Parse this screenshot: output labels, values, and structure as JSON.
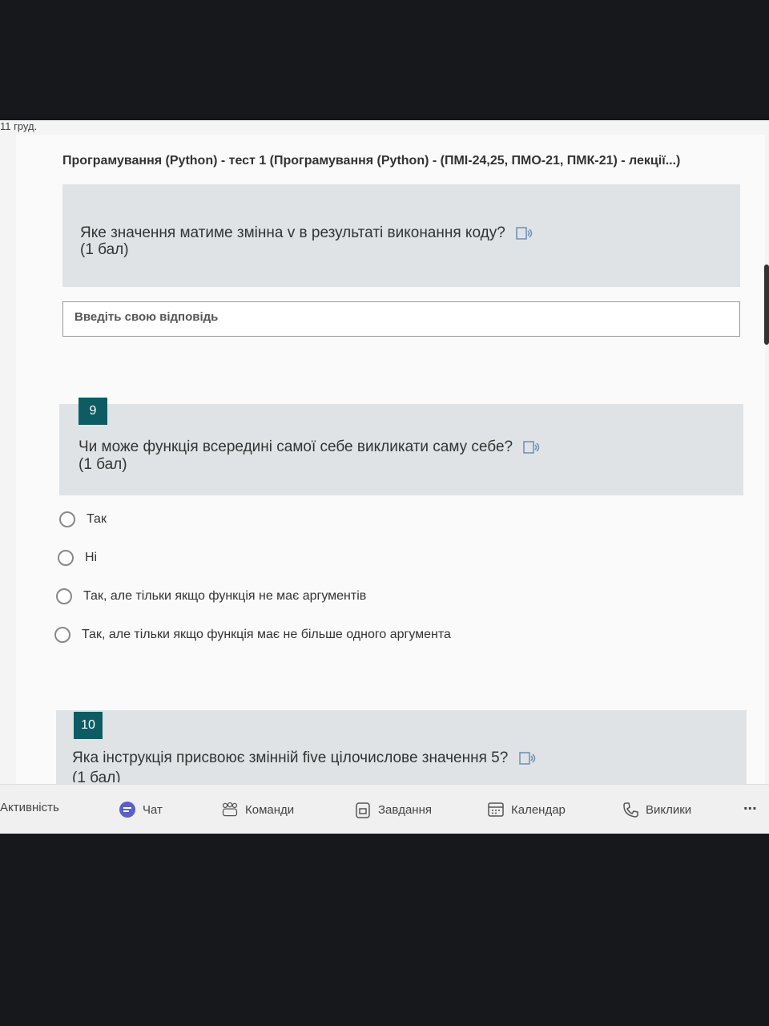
{
  "date": "11 груд.",
  "form_title": "Програмування (Python) - тест 1 (Програмування (Python) - (ПМІ-24,25, ПМО-21, ПМК-21) - лекції...)",
  "questions": [
    {
      "text": "Яке значення матиме змінна v в результаті виконання коду?",
      "points": "(1 бал)",
      "answer_placeholder": "Введіть свою відповідь"
    },
    {
      "number": "9",
      "text": "Чи може функція всередині самої себе викликати саму себе?",
      "points": "(1 бал)",
      "options": [
        "Так",
        "Ні",
        "Так, але тільки якщо функція не має аргументів",
        "Так, але тільки якщо функція має не більше одного аргумента"
      ]
    },
    {
      "number": "10",
      "text": "Яка інструкція присвоює змінній five цілочислове значення 5?",
      "points": "(1 бал)"
    }
  ],
  "taskbar": {
    "activity": "Активність",
    "chat": "Чат",
    "teams": "Команди",
    "assignments": "Завдання",
    "calendar": "Календар",
    "calls": "Виклики",
    "more": "..."
  },
  "colors": {
    "question_bg": "#dfe3e6",
    "number_badge": "#0e5c63",
    "chat_icon": "#5b5fc7"
  }
}
